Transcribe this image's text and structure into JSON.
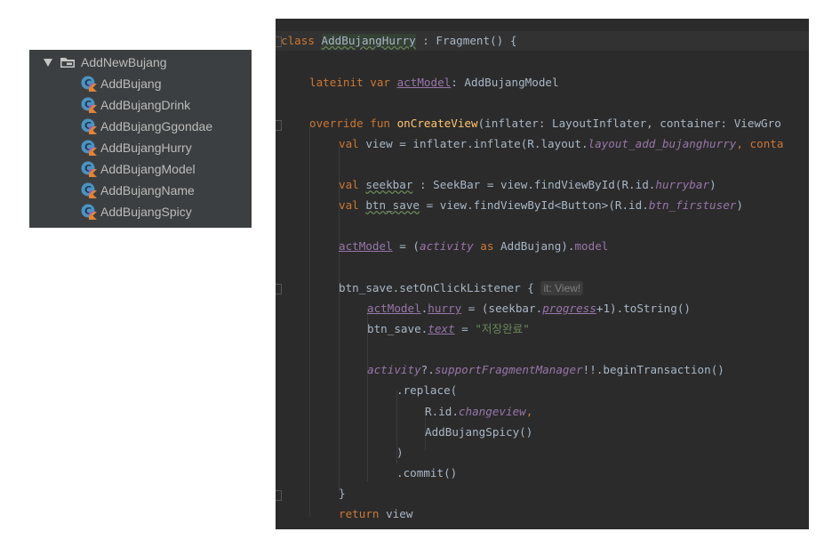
{
  "project_tree": {
    "folder": {
      "label": "AddNewBujang",
      "icon": "folder-icon"
    },
    "files": [
      {
        "label": "AddBujang",
        "icon": "kotlin-class-icon"
      },
      {
        "label": "AddBujangDrink",
        "icon": "kotlin-class-icon"
      },
      {
        "label": "AddBujangGgondae",
        "icon": "kotlin-class-icon"
      },
      {
        "label": "AddBujangHurry",
        "icon": "kotlin-class-icon"
      },
      {
        "label": "AddBujangModel",
        "icon": "kotlin-class-icon"
      },
      {
        "label": "AddBujangName",
        "icon": "kotlin-class-icon"
      },
      {
        "label": "AddBujangSpicy",
        "icon": "kotlin-class-icon"
      }
    ]
  },
  "editor": {
    "colors": {
      "background": "#2b2b2b",
      "keyword": "#cc7832",
      "function": "#ffc66d",
      "property": "#9876aa",
      "string": "#6a8759",
      "text": "#a9b7c6"
    },
    "code": {
      "l1": {
        "kw": "class",
        "name": "AddBujangHurry",
        "rest": " : Fragment() {"
      },
      "l2": {
        "kw": "lateinit var",
        "prop": "actModel",
        "rest": ": AddBujangModel"
      },
      "l3": {
        "kw": "override fun",
        "fn": "onCreateView",
        "rest": "(inflater: LayoutInflater, container: ViewGro"
      },
      "l4": {
        "kw": "val",
        "a": " view = inflater.inflate(R.layout.",
        "ital": "layout_add_bujanghurry",
        "b": ", conta"
      },
      "l5": {
        "kw": "val",
        "var": "seekbar",
        "a": " : SeekBar = view.findViewById(R.id.",
        "ital": "hurrybar",
        "b": ")"
      },
      "l6": {
        "kw": "val",
        "var": "btn_save",
        "a": " = view.findViewById<Button>(R.id.",
        "ital": "btn_firstuser",
        "b": ")"
      },
      "l7": {
        "prop": "actModel",
        "a": " = (",
        "ital": "activity",
        "kw": "as",
        "b": "AddBujang).",
        "prop2": "model"
      },
      "l8": {
        "a": "btn_save.setOnClickListener { ",
        "hint": "it: View!"
      },
      "l9": {
        "prop": "actModel",
        "dot": ".",
        "prop2": "hurry",
        "a": " = (seekbar.",
        "ital": "progress",
        "b": "+1).toString()"
      },
      "l10": {
        "a": "btn_save.",
        "ital": "text",
        "b": " = ",
        "str": "\"저장완료\""
      },
      "l11": {
        "ital": "activity",
        "a": "?.",
        "ital2": "supportFragmentManager",
        "b": "!!.beginTransaction()"
      },
      "l12": {
        "a": ".replace("
      },
      "l13": {
        "a": "R.id.",
        "ital": "changeview",
        "kw": ","
      },
      "l14": {
        "a": "AddBujangSpicy()"
      },
      "l15": {
        "a": ")"
      },
      "l16": {
        "a": ".commit()"
      },
      "l17": {
        "a": "}"
      },
      "l18": {
        "kw": "return",
        "a": " view"
      }
    }
  }
}
